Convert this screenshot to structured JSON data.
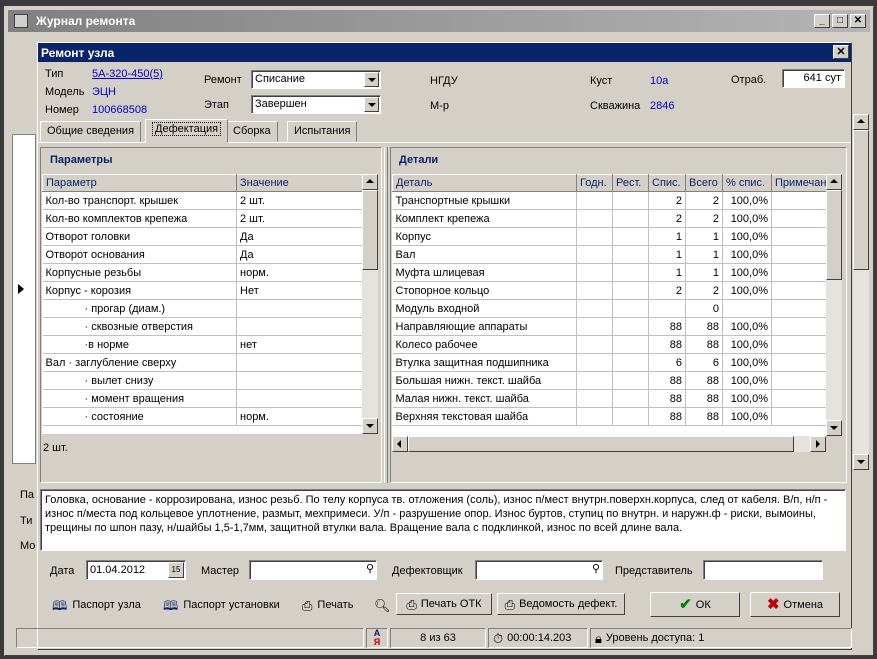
{
  "outer_window": {
    "title": "Журнал ремонта"
  },
  "dialog": {
    "title": "Ремонт узла",
    "header": {
      "type_label": "Тип",
      "type_value": "5А-320-450(5)",
      "model_label": "Модель",
      "model_value": "ЭЦН",
      "number_label": "Номер",
      "number_value": "100668508",
      "repair_label": "Ремонт",
      "repair_value": "Списание",
      "stage_label": "Этап",
      "stage_value": "Завершен",
      "ngdu_label": "НГДУ",
      "mr_label": "М-р",
      "kust_label": "Куст",
      "kust_value": "10а",
      "well_label": "Скважина",
      "well_value": "2846",
      "otrab_label": "Отраб.",
      "otrab_value": "641 сут"
    },
    "tabs": [
      "Общие сведения",
      "Дефектация",
      "Сборка",
      "Испытания"
    ],
    "params": {
      "title": "Параметры",
      "col_param": "Параметр",
      "col_value": "Значение",
      "rows": [
        [
          "Кол-во транспорт. крышек",
          "2 шт."
        ],
        [
          "Кол-во комплектов крепежа",
          "2 шт."
        ],
        [
          "Отворот головки",
          "Да"
        ],
        [
          "Отворот основания",
          "Да"
        ],
        [
          "Корпусные резьбы",
          "норм."
        ],
        [
          "Корпус - корозия",
          "Нет"
        ],
        [
          "· прогар (диам.)",
          ""
        ],
        [
          "· сквозные отверстия",
          ""
        ],
        [
          "·в норме",
          "нет"
        ],
        [
          "Вал     · заглубление сверху",
          ""
        ],
        [
          "· вылет снизу",
          ""
        ],
        [
          "· момент вращения",
          ""
        ],
        [
          "· состояние",
          "норм."
        ]
      ],
      "indent": [
        false,
        false,
        false,
        false,
        false,
        false,
        true,
        true,
        true,
        false,
        true,
        true,
        true
      ],
      "footer": "2 шт."
    },
    "details": {
      "title": "Детали",
      "columns": [
        "Деталь",
        "Годн.",
        "Рест.",
        "Спис.",
        "Всего",
        "% спис.",
        "Примечание"
      ],
      "rows": [
        [
          "Транспортные крышки",
          "",
          "",
          "2",
          "2",
          "100,0%",
          ""
        ],
        [
          "Комплект крепежа",
          "",
          "",
          "2",
          "2",
          "100,0%",
          ""
        ],
        [
          "Корпус",
          "",
          "",
          "1",
          "1",
          "100,0%",
          ""
        ],
        [
          "Вал",
          "",
          "",
          "1",
          "1",
          "100,0%",
          ""
        ],
        [
          "Муфта шлицевая",
          "",
          "",
          "1",
          "1",
          "100,0%",
          ""
        ],
        [
          "Стопорное кольцо",
          "",
          "",
          "2",
          "2",
          "100,0%",
          ""
        ],
        [
          "Модуль входной",
          "",
          "",
          "",
          "0",
          "",
          ""
        ],
        [
          "Направляющие аппараты",
          "",
          "",
          "88",
          "88",
          "100,0%",
          ""
        ],
        [
          "Колесо рабочее",
          "",
          "",
          "88",
          "88",
          "100,0%",
          ""
        ],
        [
          "Втулка защитная подшипника",
          "",
          "",
          "6",
          "6",
          "100,0%",
          ""
        ],
        [
          "Большая нижн. текст. шайба",
          "",
          "",
          "88",
          "88",
          "100,0%",
          ""
        ],
        [
          "Малая нижн. текст. шайба",
          "",
          "",
          "88",
          "88",
          "100,0%",
          ""
        ],
        [
          "Верхняя текстовая шайба",
          "",
          "",
          "88",
          "88",
          "100,0%",
          ""
        ]
      ]
    },
    "notes": "Головка, основание - коррозирована, износ резьб. По телу корпуса тв. отложения (соль), износ п/мест внутрн.поверхн.корпуса, след от кабеля. В/п, н/п - износ п/места под кольцевое уплотнение, размыт, мехпримеси. У/п - разрушение опор. Износ буртов, ступиц по внутрн. и наружн.ф - риски, вымоины, трещины по шпон пазу, н/шайбы 1,5-1,7мм, защитной втулки вала. Вращение вала с подклинкой, износ по всей длине вала.",
    "footer_fields": {
      "date_label": "Дата",
      "date_value": "01.04.2012",
      "master_label": "Мастер",
      "master_value": "",
      "defect_label": "Дефектовщик",
      "defect_value": "",
      "rep_label": "Представитель",
      "rep_value": ""
    },
    "buttons": {
      "passport_node": "Паспорт узла",
      "passport_install": "Паспорт установки",
      "print": "Печать",
      "print_otk": "Печать ОТК",
      "defect_list": "Ведомость дефект.",
      "ok": "ОК",
      "cancel": "Отмена"
    }
  },
  "statusbar": {
    "record": "8 из 63",
    "timer": "00:00:14.203",
    "access": "Уровень доступа: 1"
  },
  "outer_left_labels": [
    "Па",
    "Ти",
    "Мо"
  ],
  "colors": {
    "title_active": "#0a246a",
    "title_inactive": "#808080",
    "link_blue": "#0000cc",
    "ok_green": "#008000",
    "cancel_red": "#c00000"
  }
}
